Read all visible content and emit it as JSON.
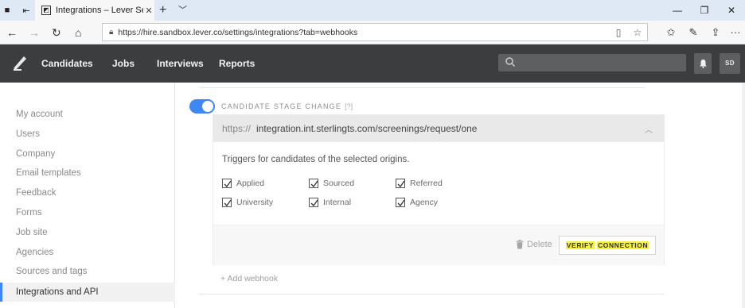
{
  "browser": {
    "tab_title": "Integrations – Lever Set",
    "new_tab": "+",
    "url": "https://hire.sandbox.lever.co/settings/integrations?tab=webhooks"
  },
  "app": {
    "nav": [
      "Candidates",
      "Jobs",
      "Interviews",
      "Reports"
    ],
    "search_placeholder": "",
    "avatar_initials": "SD"
  },
  "sidebar": {
    "items": [
      {
        "label": "My account"
      },
      {
        "label": "Users"
      },
      {
        "label": "Company"
      },
      {
        "label": "Email templates"
      },
      {
        "label": "Feedback"
      },
      {
        "label": "Forms"
      },
      {
        "label": "Job site"
      },
      {
        "label": "Agencies"
      },
      {
        "label": "Sources and tags"
      },
      {
        "label": "Integrations and API",
        "active": true
      }
    ]
  },
  "webhook": {
    "enabled": true,
    "stage_label": "CANDIDATE STAGE CHANGE",
    "help": "[?]",
    "url_prefix": "https://",
    "url_value": "integration.int.sterlingts.com/screenings/request/one",
    "triggers_text": "Triggers for candidates of the selected origins.",
    "origins": [
      {
        "label": "Applied",
        "checked": true
      },
      {
        "label": "Sourced",
        "checked": true
      },
      {
        "label": "Referred",
        "checked": true
      },
      {
        "label": "University",
        "checked": true
      },
      {
        "label": "Internal",
        "checked": true
      },
      {
        "label": "Agency",
        "checked": true
      }
    ],
    "delete_label": "Delete",
    "verify_word1": "VERIFY",
    "verify_word2": "CONNECTION"
  },
  "add_webhook": "+ Add webhook",
  "colors": {
    "accent": "#3f86f6",
    "appbar": "#3c3d3e",
    "highlight": "#f5f13a"
  }
}
